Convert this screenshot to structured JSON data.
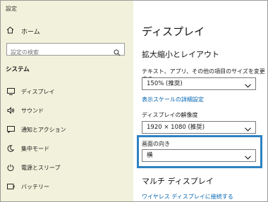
{
  "sidebar": {
    "app_title": "設定",
    "home_label": "ホーム",
    "search_placeholder": "設定の検索",
    "section_label": "システム",
    "items": [
      {
        "label": "ディスプレイ",
        "icon": "monitor-icon"
      },
      {
        "label": "サウンド",
        "icon": "speaker-icon"
      },
      {
        "label": "通知とアクション",
        "icon": "notification-icon"
      },
      {
        "label": "集中モード",
        "icon": "moon-icon"
      },
      {
        "label": "電源とスリープ",
        "icon": "power-icon"
      },
      {
        "label": "バッテリー",
        "icon": "battery-icon"
      }
    ]
  },
  "main": {
    "page_title": "ディスプレイ",
    "scale_section_title": "拡大縮小とレイアウト",
    "scale_label": "テキスト、アプリ、その他の項目のサイズを変更する",
    "scale_value": "150% (推奨)",
    "advanced_scale_link": "表示スケールの詳細設定",
    "resolution_label": "ディスプレイの解像度",
    "resolution_value": "1920 × 1080 (推奨)",
    "orientation_label": "画面の向き",
    "orientation_value": "横",
    "multi_display_title": "マルチ ディスプレイ",
    "wireless_link": "ワイヤレス ディスプレイに接続する"
  },
  "colors": {
    "sidebar_bg": "#f2f2dc",
    "link": "#0063b1",
    "highlight": "#2f82c2"
  }
}
